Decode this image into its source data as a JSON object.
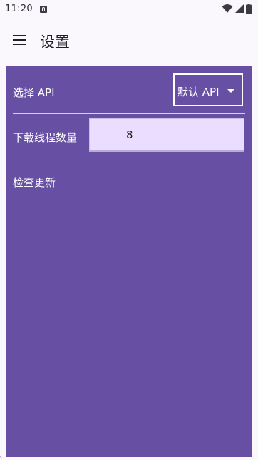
{
  "status_bar": {
    "time": "11:20",
    "icons": [
      "notification-a-icon",
      "wifi-icon",
      "signal-icon",
      "battery-icon"
    ]
  },
  "app_bar": {
    "title": "设置",
    "menu_icon": "hamburger-menu-icon"
  },
  "settings": {
    "api": {
      "label": "选择 API",
      "selected": "默认 API"
    },
    "threads": {
      "label": "下载线程数量",
      "value": "8"
    },
    "update": {
      "label": "检查更新"
    }
  },
  "colors": {
    "panel": "#6750a4",
    "input_fill": "#eaddff",
    "divider": "#d7ccf2",
    "background": "#fbf8fd"
  }
}
